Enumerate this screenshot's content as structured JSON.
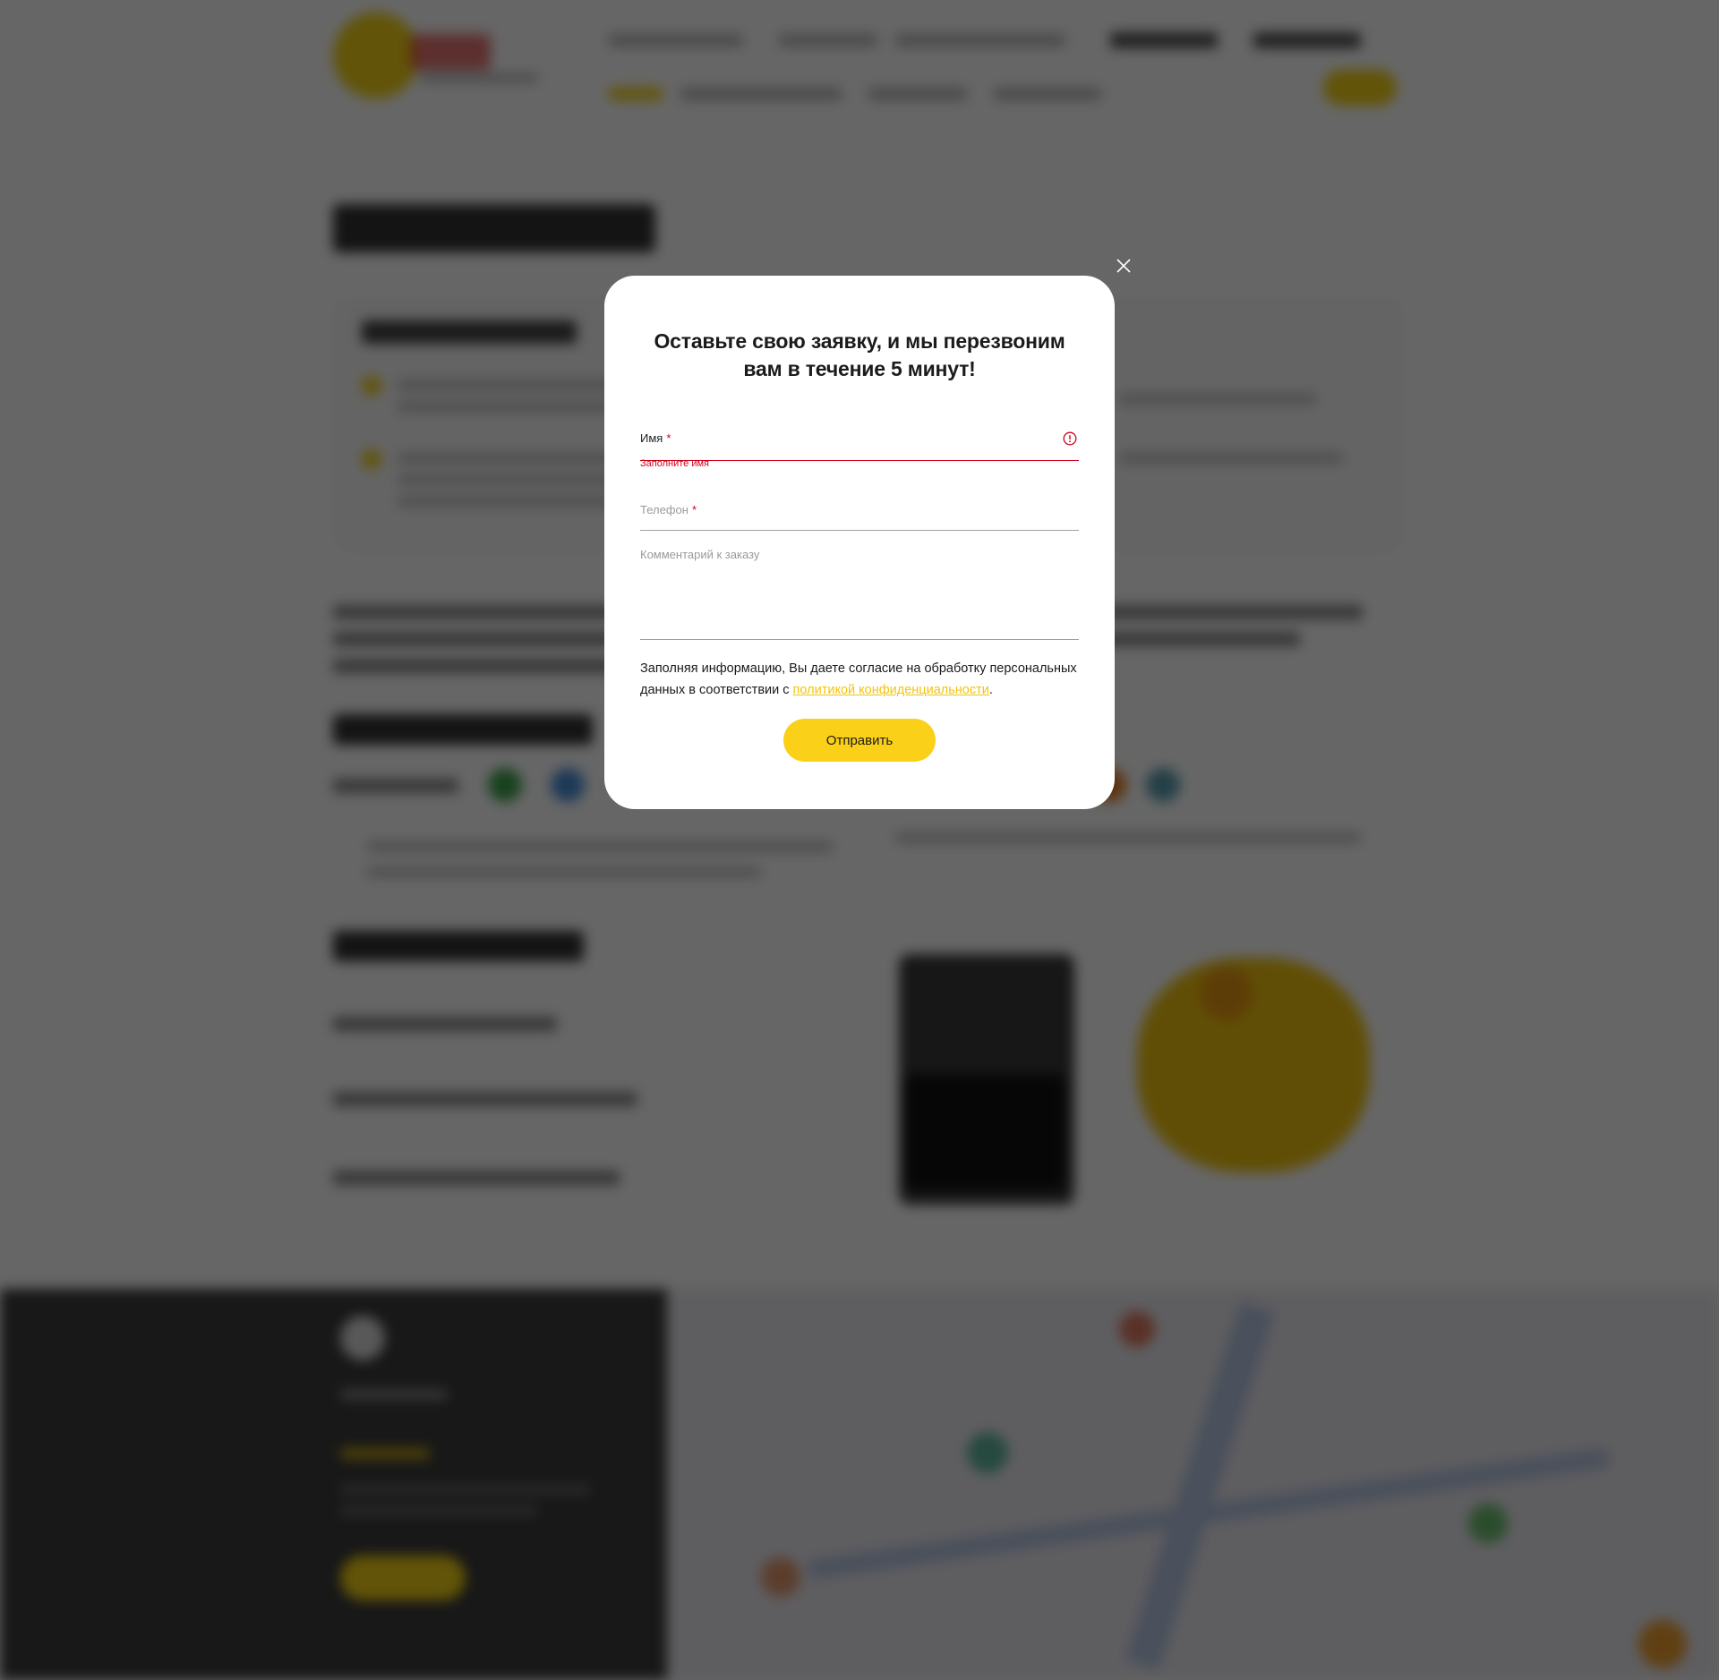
{
  "modal": {
    "title": "Оставьте свою заявку, и мы перезвоним вам в течение 5 минут!",
    "name_field": {
      "label": "Имя",
      "required_mark": "*",
      "value": "",
      "error": "Заполните имя"
    },
    "phone_field": {
      "label": "Телефон",
      "required_mark": "*",
      "value": ""
    },
    "comment_field": {
      "label": "Комментарий к заказу",
      "value": ""
    },
    "consent": {
      "text_before": "Заполняя информацию, Вы даете согласие на обработку персональных данных в соответствии с ",
      "link_text": "политикой конфиденциальности",
      "text_after": "."
    },
    "submit_label": "Отправить"
  },
  "icons": {
    "close": "close-icon",
    "error": "error-circle-icon"
  },
  "colors": {
    "accent": "#fad018",
    "error": "#d0021b",
    "link": "#f2c40f",
    "overlay": "rgba(0,0,0,0.6)"
  }
}
